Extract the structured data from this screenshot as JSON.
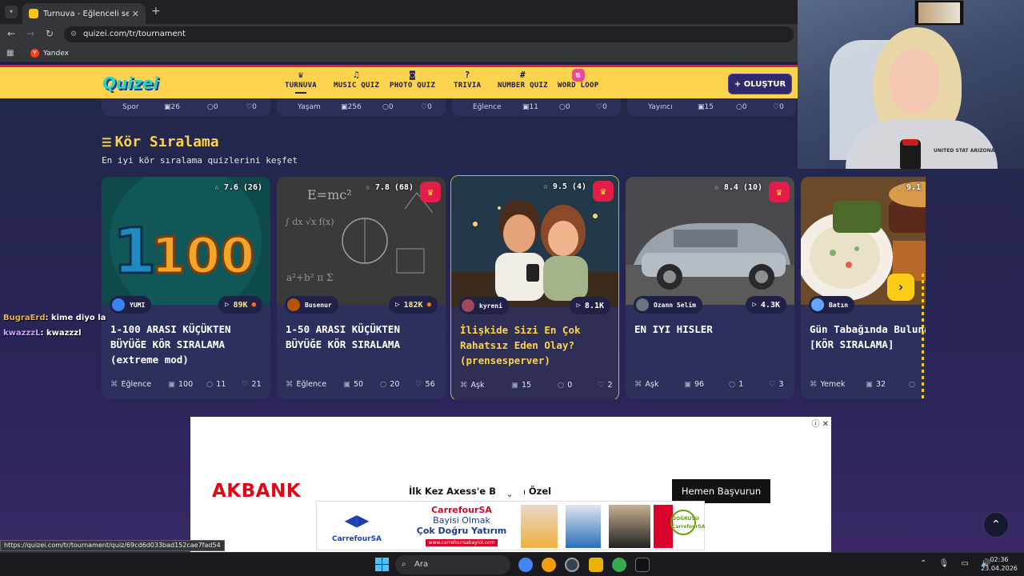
{
  "browser": {
    "tab_title": "Turnuva - Eğlenceli seçimler yap",
    "tab_close": "✕",
    "new_tab": "+",
    "url": "quizei.com/tr/tournament",
    "bookmark": "Yandex",
    "bookmark_initial": "Y",
    "status_url": "https://quizei.com/tr/tournament/quiz/69cd6d033bad152cae7fad54"
  },
  "site": {
    "logo": "Quizei",
    "nav": [
      {
        "icon": "trophy-icon",
        "glyph": "♛",
        "label": "TURNUVA",
        "active": true
      },
      {
        "icon": "music-icon",
        "glyph": "♫",
        "label": "MUSIC QUIZ"
      },
      {
        "icon": "camera-icon",
        "glyph": "◙",
        "label": "PHOTO QUIZ"
      },
      {
        "icon": "question-icon",
        "glyph": "?",
        "label": "TRIVIA"
      },
      {
        "icon": "hash-icon",
        "glyph": "#",
        "label": "NUMBER QUIZ"
      },
      {
        "icon": "loop-icon",
        "glyph": "⇅",
        "label": "WORD LOOP"
      }
    ],
    "create_label": "+ OLUŞTUR"
  },
  "prev_row": [
    {
      "category": "Spor",
      "questions": "26",
      "comments": "0",
      "likes": "0"
    },
    {
      "category": "Yaşam",
      "questions": "256",
      "comments": "0",
      "likes": "0"
    },
    {
      "category": "Eğlence",
      "questions": "11",
      "comments": "0",
      "likes": "0"
    },
    {
      "category": "Yayıncı",
      "questions": "15",
      "comments": "0",
      "likes": "0"
    }
  ],
  "section": {
    "icon_glyph": "☰",
    "title": "Kör Sıralama",
    "subtitle": "En iyi kör sıralama quizlerini keşfet"
  },
  "cards": [
    {
      "rating": "☆ 7.6 (26)",
      "crown": false,
      "author": "YUMI",
      "plays": "89K",
      "hot": true,
      "title": "1-100 ARASI KÜÇÜKTEN BÜYÜĞE KÖR SIRALAMA (extreme mod)",
      "category": "Eğlence",
      "questions": "100",
      "comments": "11",
      "likes": "21"
    },
    {
      "rating": "☆ 7.8 (68)",
      "crown": true,
      "author": "Busenur",
      "plays": "182K",
      "hot": true,
      "title": "1-50 ARASI KÜÇÜKTEN BÜYÜĞE KÖR SIRALAMA",
      "category": "Eğlence",
      "questions": "50",
      "comments": "20",
      "likes": "56"
    },
    {
      "rating": "☆ 9.5 (4)",
      "crown": true,
      "author": "kyreni",
      "plays": "8.1K",
      "hot": false,
      "title": "İlişkide Sizi En Çok Rahatsız Eden Olay? (prensesperver)",
      "category": "Aşk",
      "questions": "15",
      "comments": "0",
      "likes": "2"
    },
    {
      "rating": "☆ 8.4 (10)",
      "crown": true,
      "author": "Ozann Selim",
      "plays": "4.3K",
      "hot": false,
      "title": "EN IYI HISLER",
      "category": "Aşk",
      "questions": "96",
      "comments": "1",
      "likes": "3"
    },
    {
      "rating": "☆ 9.1",
      "crown": false,
      "author": "Batın",
      "plays": "",
      "hot": false,
      "title": "Gün Tabağında Bulunan Lezzetler [KÖR SIRALAMA]",
      "category": "Yemek",
      "questions": "32",
      "comments": "",
      "likes": ""
    }
  ],
  "chat": [
    {
      "user": "BugraErd",
      "msg": ": kime diyo la"
    },
    {
      "user": "kwazzzL",
      "msg": ": kwazzzl"
    }
  ],
  "ad": {
    "brand": "AKBANK",
    "text": "İlk Kez Axess'e Ba     lara Özel",
    "button": "Hemen Başvurun",
    "info": "ⓘ ✕",
    "collapse": "⌄"
  },
  "carrefour": {
    "brand": "CarrefourSA",
    "line1": "CarrefourSA",
    "line2": "Bayisi Olmak",
    "line3": "Çok Doğru Yatırım",
    "url": "www.carrefoursabayiol.com",
    "badge": "DOĞRUSU CarrefourSA"
  },
  "scroll_top": "⌃",
  "taskbar": {
    "search_placeholder": "Ara",
    "time": "02:36",
    "date": "23.04.2026",
    "tray": "⌃ 🎙 ▭ 🔊"
  },
  "webcam": {
    "shirt_text": "UNITED STAT ARIZONA"
  },
  "colors": {
    "accent_yellow": "#fcd34d",
    "header_red": "#e11d48",
    "card_bg": "#2d2f5c",
    "highlight_border": "#a3c64a"
  }
}
